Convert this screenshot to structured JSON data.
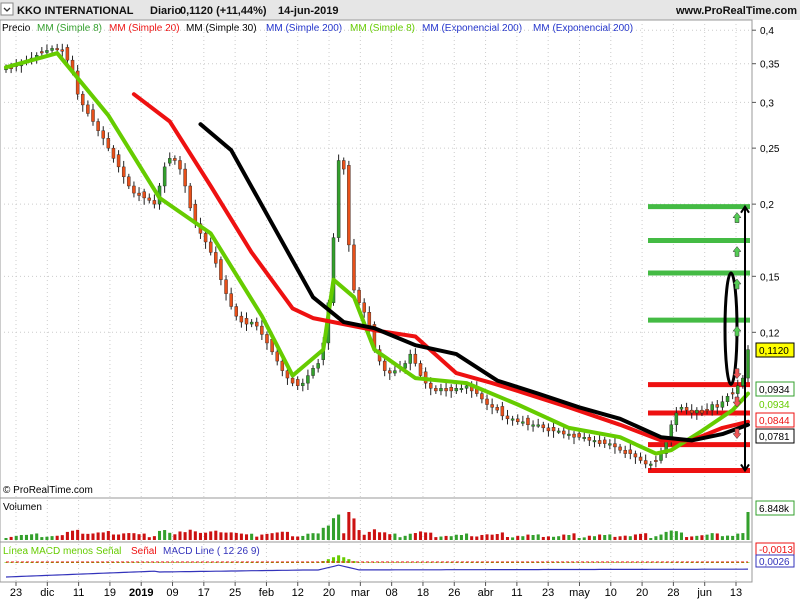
{
  "header": {
    "symbol": "KKO INTERNATIONAL",
    "period": "Diario",
    "last_price": "0,1120 (+11,44%)",
    "date": "14-jun-2019",
    "website": "www.ProRealTime.com",
    "copyright": "© ProRealTime.com"
  },
  "colors": {
    "candle_up": "#33a02c",
    "candle_down": "#e8501a",
    "sma8": "#66cc00",
    "sma20": "#ee1111",
    "sma30": "#000000",
    "target_green": "#44bb44",
    "support_red": "#ee1111",
    "macd_line": "#3333bb",
    "macd_hist": "#66cc00",
    "signal": "#ee1111",
    "volume_up": "#33a02c",
    "volume_down": "#cc1111"
  },
  "chart_data": [
    {
      "type": "candlestick",
      "panel": "Precio",
      "legend": [
        "Precio",
        "MM (Simple 8)",
        "MM (Simple 20)",
        "MM (Simple 30)",
        "MM (Simple 200)",
        "MM (Simple 8)",
        "MM (Exponencial 200)",
        "MM (Exponencial 200)"
      ],
      "x_tick_labels": [
        "23",
        "dic",
        "11",
        "19",
        "2019",
        "09",
        "17",
        "25",
        "feb",
        "12",
        "20",
        "mar",
        "08",
        "18",
        "26",
        "abr",
        "11",
        "23",
        "may",
        "10",
        "20",
        "28",
        "jun",
        "13"
      ],
      "y_tick_labels": [
        "0,4",
        "0,35",
        "0,3",
        "0,25",
        "0,2",
        "0,15",
        "0,12"
      ],
      "y_scale": "log",
      "ylim": [
        0.063,
        0.41
      ],
      "closes": [
        0.345,
        0.343,
        0.347,
        0.352,
        0.355,
        0.358,
        0.362,
        0.366,
        0.369,
        0.372,
        0.37,
        0.368,
        0.355,
        0.34,
        0.31,
        0.297,
        0.287,
        0.278,
        0.268,
        0.26,
        0.25,
        0.24,
        0.232,
        0.223,
        0.215,
        0.209,
        0.207,
        0.205,
        0.203,
        0.2,
        0.215,
        0.232,
        0.24,
        0.238,
        0.23,
        0.215,
        0.197,
        0.185,
        0.178,
        0.172,
        0.165,
        0.158,
        0.148,
        0.14,
        0.133,
        0.128,
        0.125,
        0.124,
        0.125,
        0.123,
        0.119,
        0.115,
        0.111,
        0.107,
        0.103,
        0.1,
        0.098,
        0.097,
        0.098,
        0.101,
        0.104,
        0.106,
        0.115,
        0.135,
        0.175,
        0.238,
        0.23,
        0.17,
        0.142,
        0.135,
        0.13,
        0.122,
        0.112,
        0.107,
        0.103,
        0.102,
        0.103,
        0.104,
        0.106,
        0.11,
        0.106,
        0.101,
        0.098,
        0.096,
        0.095,
        0.096,
        0.095,
        0.095,
        0.096,
        0.096,
        0.097,
        0.095,
        0.094,
        0.092,
        0.09,
        0.089,
        0.088,
        0.086,
        0.085,
        0.085,
        0.084,
        0.084,
        0.083,
        0.083,
        0.083,
        0.082,
        0.081,
        0.081,
        0.081,
        0.08,
        0.08,
        0.079,
        0.079,
        0.079,
        0.078,
        0.078,
        0.077,
        0.077,
        0.077,
        0.076,
        0.075,
        0.074,
        0.074,
        0.073,
        0.072,
        0.071,
        0.071,
        0.072,
        0.074,
        0.078,
        0.083,
        0.087,
        0.089,
        0.088,
        0.087,
        0.088,
        0.087,
        0.088,
        0.09,
        0.089,
        0.091,
        0.093,
        0.094,
        0.097,
        0.1,
        0.112
      ],
      "series": [
        {
          "name": "MM (Simple 8)",
          "approx_values": [
            [
              0,
              0.345
            ],
            [
              10,
              0.365
            ],
            [
              20,
              0.285
            ],
            [
              30,
              0.205
            ],
            [
              40,
              0.178
            ],
            [
              50,
              0.128
            ],
            [
              56,
              0.101
            ],
            [
              62,
              0.112
            ],
            [
              64,
              0.148
            ],
            [
              68,
              0.138
            ],
            [
              72,
              0.112
            ],
            [
              80,
              0.1
            ],
            [
              90,
              0.098
            ],
            [
              100,
              0.09
            ],
            [
              110,
              0.082
            ],
            [
              120,
              0.079
            ],
            [
              127,
              0.074
            ],
            [
              130,
              0.075
            ],
            [
              136,
              0.081
            ],
            [
              142,
              0.088
            ],
            [
              145,
              0.094
            ]
          ]
        },
        {
          "name": "MM (Simple 20)",
          "approx_values": [
            [
              25,
              0.31
            ],
            [
              32,
              0.278
            ],
            [
              40,
              0.215
            ],
            [
              48,
              0.165
            ],
            [
              56,
              0.132
            ],
            [
              60,
              0.127
            ],
            [
              66,
              0.124
            ],
            [
              72,
              0.121
            ],
            [
              80,
              0.118
            ],
            [
              88,
              0.102
            ],
            [
              95,
              0.098
            ],
            [
              100,
              0.095
            ],
            [
              110,
              0.089
            ],
            [
              120,
              0.083
            ],
            [
              128,
              0.078
            ],
            [
              134,
              0.078
            ],
            [
              140,
              0.082
            ],
            [
              145,
              0.084
            ]
          ]
        },
        {
          "name": "MM (Simple 30)",
          "approx_values": [
            [
              38,
              0.275
            ],
            [
              44,
              0.248
            ],
            [
              52,
              0.185
            ],
            [
              60,
              0.138
            ],
            [
              66,
              0.125
            ],
            [
              72,
              0.122
            ],
            [
              80,
              0.114
            ],
            [
              88,
              0.11
            ],
            [
              96,
              0.099
            ],
            [
              104,
              0.094
            ],
            [
              112,
              0.089
            ],
            [
              120,
              0.085
            ],
            [
              128,
              0.079
            ],
            [
              134,
              0.078
            ],
            [
              140,
              0.08
            ],
            [
              145,
              0.083
            ]
          ]
        }
      ],
      "price_labels": [
        "0,1120",
        "0,0934",
        "0,0934",
        "0,0844",
        "0,0781"
      ],
      "target_levels_green": [
        0.198,
        0.173,
        0.152,
        0.126
      ],
      "support_levels_red": [
        0.0974,
        0.087,
        0.0767,
        0.0692
      ]
    },
    {
      "type": "bar",
      "panel": "Volumen",
      "last_value": "6.848k"
    },
    {
      "type": "line",
      "panel": "MACD",
      "legend": [
        "Línea MACD menos Señal",
        "Señal",
        "MACD Line ( 12 26 9)"
      ],
      "value_labels": [
        "-0,0013",
        "0,0026"
      ]
    }
  ]
}
